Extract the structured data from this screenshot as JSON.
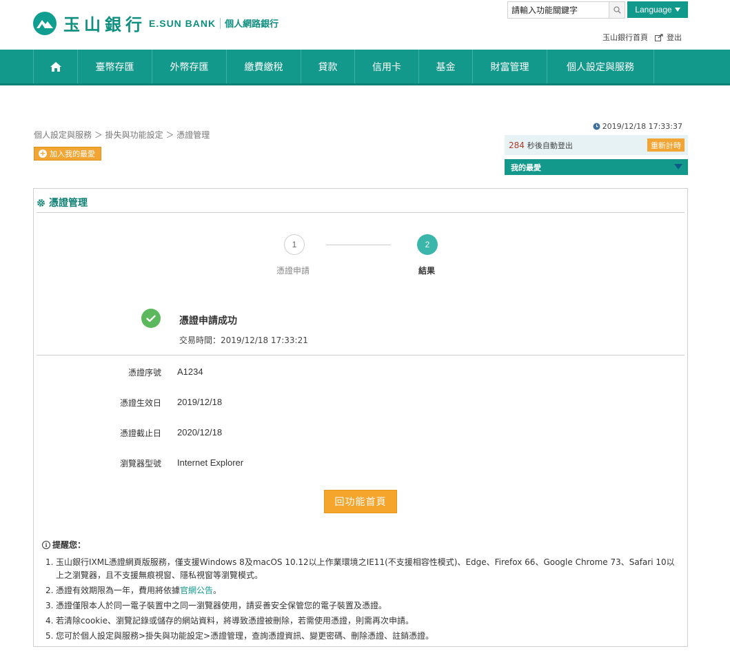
{
  "header": {
    "bank_name_cn": "玉山銀行",
    "bank_name_en": "E.SUN BANK",
    "bank_sub": "個人網路銀行",
    "search_placeholder": "請輸入功能關鍵字",
    "language_label": "Language",
    "home_link": "玉山銀行首頁",
    "logout_link": "登出"
  },
  "nav": {
    "items": [
      "臺幣存匯",
      "外幣存匯",
      "繳費繳稅",
      "貸款",
      "信用卡",
      "基金",
      "財富管理",
      "個人設定與服務"
    ]
  },
  "breadcrumb": {
    "text": "個人設定與服務 ＞ 掛失與功能設定 ＞ 憑證管理"
  },
  "favorite_button": "加入我的最愛",
  "session": {
    "datetime": "2019/12/18 17:33:37",
    "countdown": "284",
    "countdown_suffix": "秒後自動登出",
    "refresh_label": "重新計時",
    "my_favorites": "我的最愛"
  },
  "panel": {
    "title": "憑證管理",
    "steps": [
      {
        "number": "1",
        "label": "憑證申請"
      },
      {
        "number": "2",
        "label": "結果"
      }
    ],
    "success_title": "憑證申請成功",
    "success_time": "交易時間：2019/12/18 17:33:21",
    "details": [
      {
        "label": "憑證序號",
        "value": "A1234"
      },
      {
        "label": "憑證生效日",
        "value": "2019/12/18"
      },
      {
        "label": "憑證截止日",
        "value": "2020/12/18"
      },
      {
        "label": "瀏覽器型號",
        "value": "Internet Explorer"
      }
    ],
    "back_button": "回功能首頁"
  },
  "notes": {
    "heading": "提醒您：",
    "items": [
      {
        "num": "1.",
        "text": "玉山銀行IXML憑證網頁版服務，僅支援Windows 8及macOS 10.12以上作業環境之IE11(不支援相容性模式)、Edge、Firefox 66、Google Chrome 73、Safari 10以上之瀏覽器，且不支援無痕視窗、隱私視窗等瀏覽模式。"
      },
      {
        "num": "2.",
        "text_before": "憑證有效期限為一年，費用將依據",
        "link": "官網公告",
        "text_after": "。"
      },
      {
        "num": "3.",
        "text": "憑證僅限本人於同一電子裝置中之同一瀏覽器使用，請妥善安全保管您的電子裝置及憑證。"
      },
      {
        "num": "4.",
        "text": "若清除cookie、瀏覽記錄或儲存的網站資料，將導致憑證被刪除，若需使用憑證，則需再次申請。"
      },
      {
        "num": "5.",
        "text": "您可於個人設定與服務>掛失與功能設定>憑證管理，查詢憑證資訊、變更密碼、刪除憑證、註銷憑證。"
      }
    ]
  },
  "colors": {
    "brand": "#12998c",
    "accent_orange": "#f5a52c",
    "success_green": "#5cb85c"
  }
}
